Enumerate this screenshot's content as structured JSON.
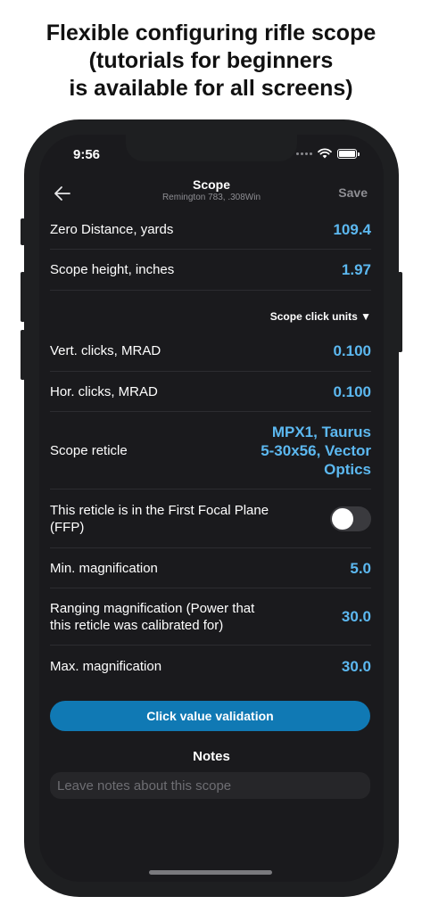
{
  "promo": {
    "line1": "Flexible configuring rifle scope",
    "line2": "(tutorials for beginners",
    "line3": "is available for all screens)"
  },
  "status_bar": {
    "time": "9:56"
  },
  "nav": {
    "title": "Scope",
    "subtitle": "Remington 783, .308Win",
    "save_label": "Save",
    "back_icon": "arrow-left-icon"
  },
  "fields": {
    "zero_distance": {
      "label": "Zero Distance, yards",
      "value": "109.4"
    },
    "scope_height": {
      "label": "Scope height, inches",
      "value": "1.97"
    },
    "click_units": {
      "label": "Scope click units ▼"
    },
    "vert_clicks": {
      "label": "Vert. clicks, MRAD",
      "value": "0.100"
    },
    "hor_clicks": {
      "label": "Hor. clicks, MRAD",
      "value": "0.100"
    },
    "reticle": {
      "label": "Scope reticle",
      "value_line1": "MPX1, Taurus",
      "value_line2": "5-30x56, Vector",
      "value_line3": "Optics"
    },
    "ffp": {
      "label_line1": "This reticle is in the First Focal Plane",
      "label_line2": "(FFP)",
      "enabled": false
    },
    "min_mag": {
      "label": "Min. magnification",
      "value": "5.0"
    },
    "ranging_mag": {
      "label_line1": "Ranging magnification (Power that",
      "label_line2": "this reticle was calibrated for)",
      "value": "30.0"
    },
    "max_mag": {
      "label": "Max. magnification",
      "value": "30.0"
    }
  },
  "actions": {
    "validate_label": "Click value validation"
  },
  "notes": {
    "title": "Notes",
    "placeholder": "Leave notes about this scope",
    "value": ""
  },
  "colors": {
    "accent_value": "#5cb8f0",
    "button": "#1079b4",
    "background": "#1a1a1d"
  }
}
